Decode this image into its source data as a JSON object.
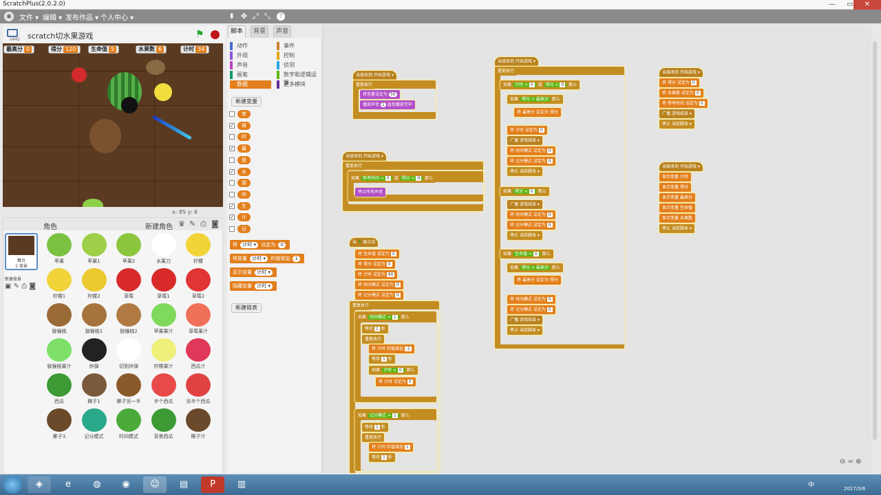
{
  "window": {
    "title": "ScratchPlus(2.0.2.0)",
    "min": "—",
    "max": "▭",
    "close": "✕"
  },
  "menubar": {
    "logo": "◉",
    "menus": [
      "文件 ▾",
      "编辑 ▾",
      "发布作品 ▾",
      "个人中心 ▾"
    ],
    "tools": [
      "⬍",
      "✥",
      "⤢",
      "⤡",
      "?"
    ]
  },
  "stage": {
    "project_name": "scratch切水果游戏",
    "version": "v442",
    "coords": "x: 85   y: 6",
    "monitors": [
      {
        "label": "最高分",
        "value": "0"
      },
      {
        "label": "得分",
        "value": "120"
      },
      {
        "label": "生命值",
        "value": "5"
      },
      {
        "label": "水果数",
        "value": "6"
      },
      {
        "label": "计时",
        "value": "34"
      }
    ]
  },
  "tabs": [
    "脚本",
    "背景",
    "声音"
  ],
  "categories": [
    {
      "label": "动作",
      "color": "#4a6cd4"
    },
    {
      "label": "外观",
      "color": "#8a55d7"
    },
    {
      "label": "声音",
      "color": "#bb42c3"
    },
    {
      "label": "画笔",
      "color": "#0e9a6c"
    },
    {
      "label": "数据",
      "color": "#ee7d16",
      "active": true
    },
    {
      "label": "事件",
      "color": "#c88330"
    },
    {
      "label": "控制",
      "color": "#e1a91a"
    },
    {
      "label": "侦测",
      "color": "#2ca5e2"
    },
    {
      "label": "数字和逻辑运算",
      "color": "#5cb712"
    },
    {
      "label": "更多模块",
      "color": "#632d99"
    }
  ],
  "palette": {
    "new_var_button": "新建变量",
    "variables": [
      {
        "name": "参考时间",
        "checked": false
      },
      {
        "name": "得分",
        "checked": true
      },
      {
        "name": "时间模式",
        "checked": false
      },
      {
        "name": "最高分",
        "checked": true
      },
      {
        "name": "是否处在游戏中",
        "checked": false
      },
      {
        "name": "水果数",
        "checked": true
      },
      {
        "name": "游戏模式变量",
        "checked": false
      },
      {
        "name": "炸弹等待",
        "checked": false
      },
      {
        "name": "生命值",
        "checked": true
      },
      {
        "name": "计时",
        "checked": true
      },
      {
        "name": "记分模式",
        "checked": false
      }
    ],
    "blocks": [
      {
        "text": "将",
        "slot": "计时 ▾",
        "tail": "设定为",
        "slot2": "0"
      },
      {
        "text": "将变量",
        "slot": "计时 ▾",
        "tail": "的值增加",
        "slot2": "1"
      },
      {
        "text": "显示变量",
        "slot": "计时 ▾",
        "tail": "",
        "slot2": ""
      },
      {
        "text": "隐藏变量",
        "slot": "计时 ▾",
        "tail": "",
        "slot2": ""
      }
    ],
    "new_list_button": "新建链表"
  },
  "sprites": {
    "header_label": "角色",
    "new_sprite": "新建角色",
    "stage_label": "舞台",
    "stage_sub": "2 背景",
    "new_backdrop": "新建背景",
    "items": [
      {
        "name": "苹果",
        "color": "#7cc242"
      },
      {
        "name": "苹果1",
        "color": "#9dd048"
      },
      {
        "name": "苹果2",
        "color": "#8cc63f"
      },
      {
        "name": "水果刀",
        "color": "#ffffff"
      },
      {
        "name": "柠檬",
        "color": "#f0d43a"
      },
      {
        "name": "柠檬1",
        "color": "#f0d43a"
      },
      {
        "name": "柠檬2",
        "color": "#ecc92e"
      },
      {
        "name": "草莓",
        "color": "#d92a2a"
      },
      {
        "name": "草莓1",
        "color": "#d92a2a"
      },
      {
        "name": "草莓2",
        "color": "#e03535"
      },
      {
        "name": "猕猴桃",
        "color": "#9a6a37"
      },
      {
        "name": "猕猴桃1",
        "color": "#a6733c"
      },
      {
        "name": "猕猴桃2",
        "color": "#b07a42"
      },
      {
        "name": "苹果果汁",
        "color": "#7fd95a"
      },
      {
        "name": "草莓果汁",
        "color": "#f0705a"
      },
      {
        "name": "猕猴桃果汁",
        "color": "#7ee06a"
      },
      {
        "name": "炸弹",
        "color": "#222222"
      },
      {
        "name": "切到炸弹",
        "color": "#ffffff"
      },
      {
        "name": "柠檬果汁",
        "color": "#eef07a"
      },
      {
        "name": "西瓜汁",
        "color": "#e0385a"
      },
      {
        "name": "西瓜",
        "color": "#3d9a35"
      },
      {
        "name": "椰子1",
        "color": "#7a5a3a"
      },
      {
        "name": "椰子另一半",
        "color": "#8a5a2a"
      },
      {
        "name": "半个西瓜",
        "color": "#e84a4a"
      },
      {
        "name": "另半个西瓜",
        "color": "#e04242"
      },
      {
        "name": "椰子3",
        "color": "#6a4a2a"
      },
      {
        "name": "记分模式",
        "color": "#2aa88a"
      },
      {
        "name": "时间模式",
        "color": "#4aaa3a"
      },
      {
        "name": "背景西瓜",
        "color": "#3d9a35"
      },
      {
        "name": "椰子汁",
        "color": "#6a4a2a"
      }
    ]
  },
  "scripts": {
    "when_receive": "当接收到",
    "start_game": "开始游戏 ▾",
    "forever": "重复执行",
    "if": "如果",
    "then": "那么",
    "or": "或",
    "set": "将",
    "set_to": "设定为",
    "score": "得分",
    "timer": "计时",
    "max": "最高分",
    "life": "生命值",
    "fruit": "水果数",
    "time_mode": "时间模式",
    "score_mode": "记分模式",
    "ref_time": "参考时间",
    "broadcast": "广播",
    "game_over": "游戏结束 ▾",
    "stop": "停止",
    "stop_this": "当前脚本 ▾",
    "stop_all": "停止所有声音",
    "set_volume": "将音量设定为",
    "play_sound": "播放声音",
    "play_until": "直到播放完毕",
    "wait": "等待",
    "secs": "秒",
    "change_by": "的值增加",
    "when_flag": "当",
    "clicked": "被点击",
    "show_var": "显示变量",
    "n0": "0",
    "n1": "1",
    "n5": "5",
    "n50": "50",
    "n60": "60",
    "nm1": "-1",
    "lt": "<",
    "gt": ">",
    "eq": "="
  },
  "taskbar": {
    "time": "2017/3/6",
    "lang": "中"
  }
}
